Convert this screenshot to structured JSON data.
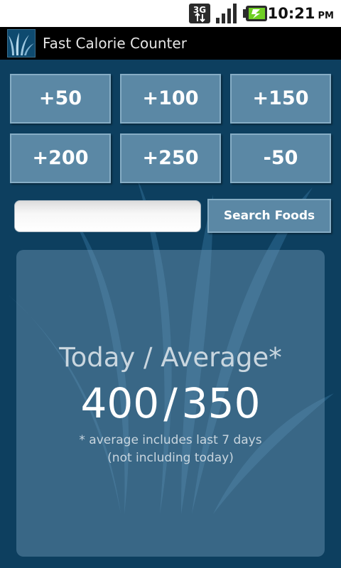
{
  "status_bar": {
    "network": "3G",
    "time": "10:21",
    "ampm": "PM",
    "icons": [
      "3g-data-icon",
      "signal-strength-icon",
      "battery-charging-icon"
    ]
  },
  "app": {
    "title": "Fast Calorie Counter",
    "icon": "grass-app-icon",
    "accent": "#0d3f5f",
    "button_color": "#5b88a5"
  },
  "quick_add_buttons": [
    "+50",
    "+100",
    "+150",
    "+200",
    "+250",
    "-50"
  ],
  "search": {
    "value": "",
    "button_label": "Search Foods"
  },
  "summary": {
    "heading": "Today / Average*",
    "today": "400",
    "separator": "/",
    "average": "350",
    "note_line1": "* average includes last 7 days",
    "note_line2": "(not including today)"
  }
}
